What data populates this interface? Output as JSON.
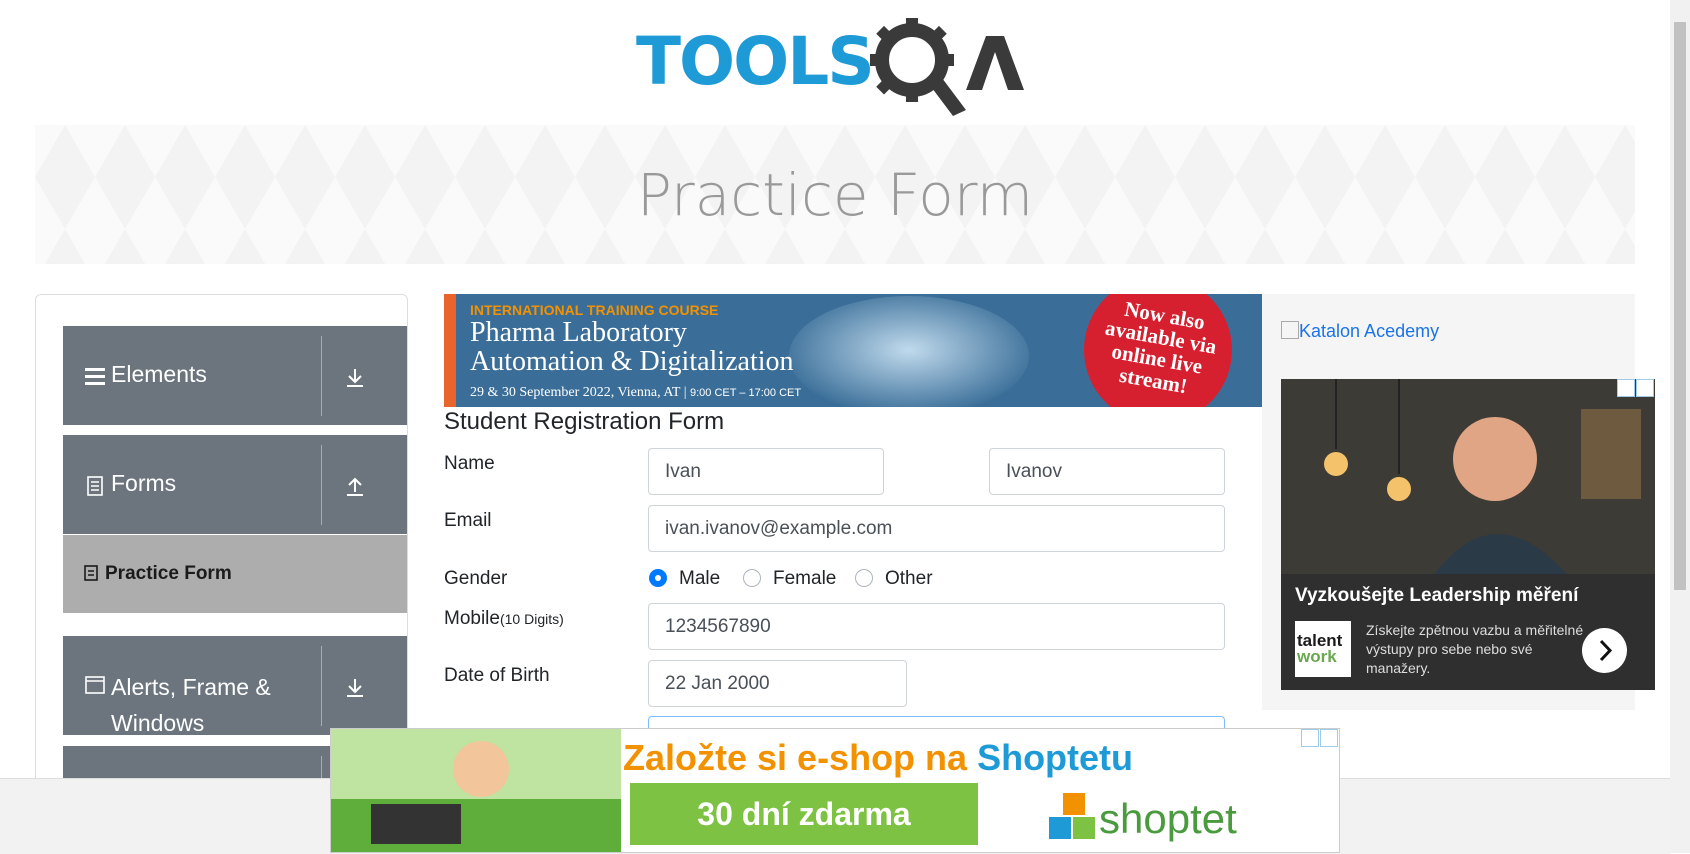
{
  "header": {
    "logo_text": "TOOLSQA"
  },
  "banner": {
    "title": "Practice Form"
  },
  "sidebar": {
    "groups": [
      {
        "label": "Elements",
        "icon": "hamburger-icon",
        "state": "collapsed"
      },
      {
        "label": "Forms",
        "icon": "document-icon",
        "state": "expanded",
        "items": [
          {
            "label": "Practice Form",
            "icon": "form-icon",
            "active": true
          }
        ]
      },
      {
        "label": "Alerts, Frame & Windows",
        "label_line1": "Alerts, Frame &",
        "label_line2": "Windows",
        "icon": "window-icon",
        "state": "collapsed"
      }
    ]
  },
  "ads": {
    "pharma": {
      "kicker": "INTERNATIONAL TRAINING COURSE",
      "line1": "Pharma Laboratory",
      "line2": "Automation & Digitalization",
      "date": "29 & 30 September 2022, Vienna, AT",
      "time": "9:00 CET – 17:00 CET",
      "badge": [
        "Now also",
        "available via",
        "online live",
        "stream!"
      ]
    },
    "katalon": {
      "alt": "Katalon Acedemy"
    },
    "leadership": {
      "title": "Vyzkoušejte Leadership měření",
      "text": "Získejte zpětnou vazbu a měřitelné výstupy pro sebe nebo své manažery.",
      "logo_top": "talent",
      "logo_bottom": "work"
    },
    "shoptet": {
      "headline_part1": "Založte si e-shop na ",
      "headline_part2": "Shoptetu",
      "button": "30 dní zdarma",
      "brand": "shoptet"
    }
  },
  "form": {
    "title": "Student Registration Form",
    "name_label": "Name",
    "first_name": "Ivan",
    "last_name": "Ivanov",
    "email_label": "Email",
    "email": "ivan.ivanov@example.com",
    "gender_label": "Gender",
    "gender_options": [
      "Male",
      "Female",
      "Other"
    ],
    "gender_selected": "Male",
    "mobile_label": "Mobile",
    "mobile_hint": "(10 Digits)",
    "mobile": "1234567890",
    "dob_label": "Date of Birth",
    "dob": "22 Jan 2000"
  },
  "colors": {
    "sidebar_group": "#6c757d",
    "sidebar_active": "#adadad",
    "radio_checked": "#007bff",
    "logo_blue": "#1e9ad6",
    "logo_dark": "#3a3a3a"
  }
}
